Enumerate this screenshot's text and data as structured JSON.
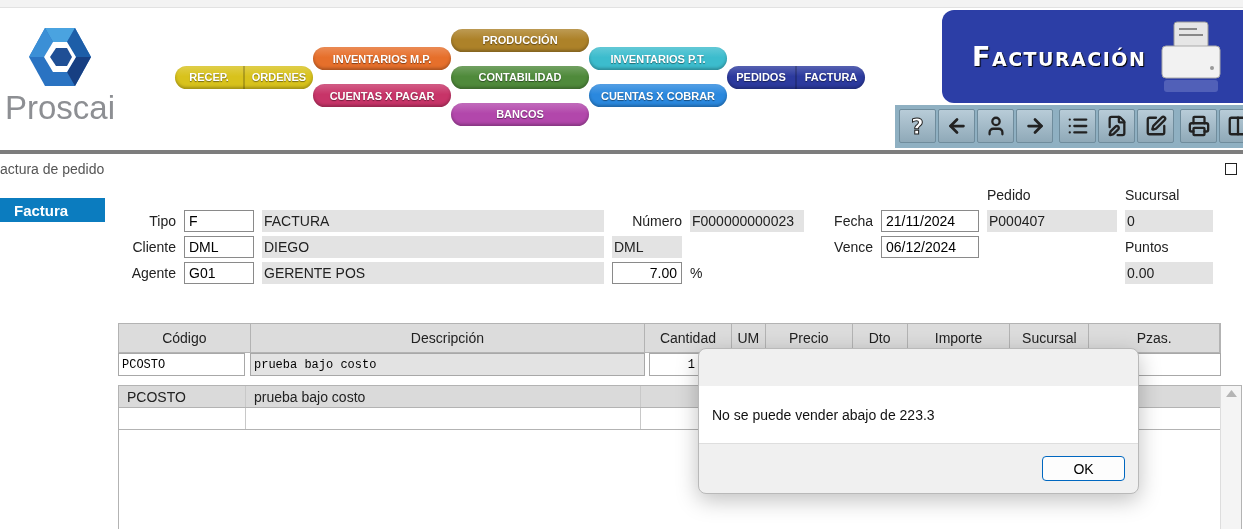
{
  "logo": {
    "name": "Proscai"
  },
  "nav_columns": [
    {
      "items": [
        {
          "kind": "split",
          "labels": [
            "RECEP.",
            "ORDENES"
          ],
          "color": "#d8c21c"
        }
      ]
    },
    {
      "items": [
        {
          "kind": "pill",
          "label": "INVENTARIOS M.P.",
          "color": "#e66f2b"
        },
        {
          "kind": "pill",
          "label": "CUENTAS X PAGAR",
          "color": "#c73468"
        }
      ]
    },
    {
      "items": [
        {
          "kind": "pill",
          "label": "PRODUCCIÓN",
          "color": "#ad8229"
        },
        {
          "kind": "pill",
          "label": "CONTABILIDAD",
          "color": "#4f8a3b"
        },
        {
          "kind": "pill",
          "label": "BANCOS",
          "color": "#b247ab"
        }
      ]
    },
    {
      "items": [
        {
          "kind": "pill",
          "label": "INVENTARIOS P.T.",
          "color": "#3cbccd"
        },
        {
          "kind": "pill",
          "label": "CUENTAS X COBRAR",
          "color": "#2a88de"
        }
      ]
    },
    {
      "items": [
        {
          "kind": "split",
          "labels": [
            "PEDIDOS",
            "FACTURA"
          ],
          "color": "#2c3a9e"
        }
      ]
    }
  ],
  "banner": {
    "title": "FACTURACIÓN"
  },
  "toolbar": {
    "help_glyph": "?"
  },
  "window_title": "actura de pedido",
  "sidebar": {
    "items": [
      {
        "label": "Factura",
        "selected": true
      }
    ]
  },
  "header": {
    "tipo": {
      "label": "Tipo",
      "value": "F",
      "description": "FACTURA"
    },
    "cliente": {
      "label": "Cliente",
      "value": "DML",
      "description": "DIEGO",
      "extra": "DML"
    },
    "agente": {
      "label": "Agente",
      "value": "G01",
      "description": "GERENTE POS",
      "rate": "7.00",
      "rate_unit": "%"
    },
    "numero": {
      "label": "Número",
      "value": "F000000000023"
    },
    "fecha": {
      "label": "Fecha",
      "value": "21/11/2024"
    },
    "vence": {
      "label": "Vence",
      "value": "06/12/2024"
    },
    "pedido": {
      "label": "Pedido",
      "value": "P000407"
    },
    "sucursal": {
      "label": "Sucursal",
      "value": "0"
    },
    "puntos": {
      "label": "Puntos",
      "value": "0.00"
    }
  },
  "table": {
    "columns": [
      "Código",
      "Descripción",
      "Cantidad",
      "UM",
      "Precio",
      "Dto",
      "Importe",
      "Sucursal",
      "Pzas."
    ],
    "entry_row": {
      "code": "PCOSTO",
      "description": "prueba bajo costo",
      "quantity": "1"
    }
  },
  "grid": {
    "rows": [
      {
        "code": "PCOSTO",
        "description": "prueba bajo costo",
        "selected": true
      }
    ]
  },
  "dialog": {
    "message": "No se puede vender abajo de 223.3",
    "button": "OK"
  }
}
